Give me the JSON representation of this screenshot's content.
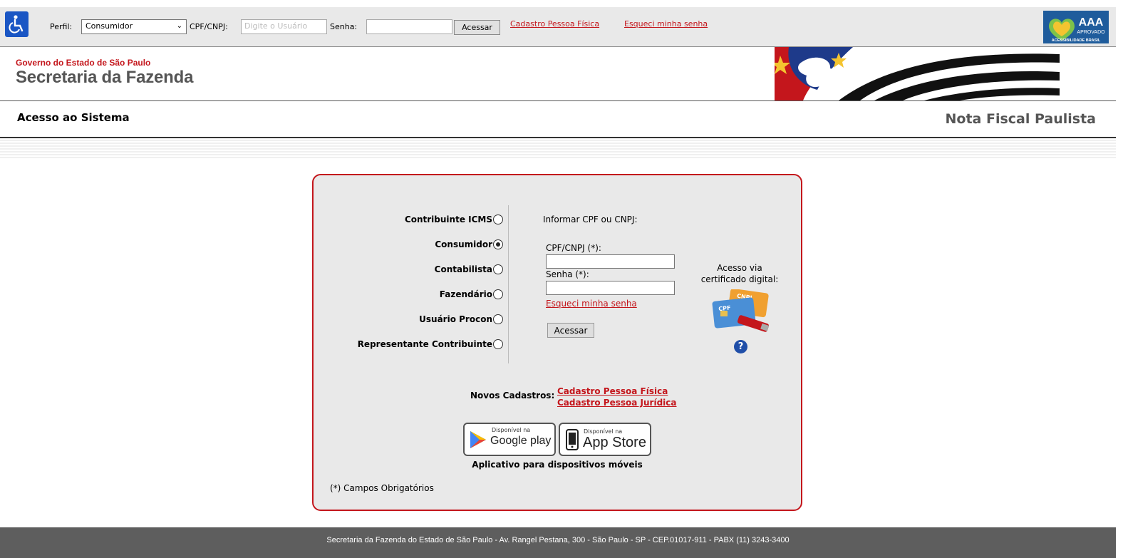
{
  "topbar": {
    "perfil_label": "Perfil:",
    "perfil_selected": "Consumidor",
    "cpf_label": "CPF/CNPJ:",
    "cpf_placeholder": "Digite o Usuário",
    "senha_label": "Senha:",
    "acessar_label": "Acessar",
    "link_cadastro": "Cadastro Pessoa Física",
    "link_esqueci": "Esqueci minha senha",
    "badge": {
      "title": "AAA",
      "sub": "APROVADO",
      "caption": "ACESSIBILIDADE BRASIL"
    }
  },
  "header": {
    "gov": "Governo do Estado de São Paulo",
    "secretaria": "Secretaria da Fazenda"
  },
  "subheader": {
    "title": "Acesso ao Sistema",
    "system": "Nota Fiscal Paulista"
  },
  "login": {
    "roles": [
      {
        "label": "Contribuinte ICMS",
        "checked": false
      },
      {
        "label": "Consumidor",
        "checked": true
      },
      {
        "label": "Contabilista",
        "checked": false
      },
      {
        "label": "Fazendário",
        "checked": false
      },
      {
        "label": "Usuário Procon",
        "checked": false
      },
      {
        "label": "Representante Contribuinte",
        "checked": false
      }
    ],
    "info_title": "Informar CPF ou CNPJ:",
    "cpf_label": "CPF/CNPJ (*):",
    "senha_label": "Senha (*):",
    "forgot": "Esqueci minha senha",
    "acessar": "Acessar",
    "cert_line1": "Acesso via",
    "cert_line2": "certificado digital:",
    "cert_card1": "CNPJ",
    "cert_card2": "CPF",
    "help": "?",
    "novos_label": "Novos Cadastros:",
    "novos_links": [
      "Cadastro Pessoa Física",
      "Cadastro Pessoa Jurídica"
    ],
    "gplay_small": "Disponível na",
    "gplay_big": "Google play",
    "appstore_small": "Disponível na",
    "appstore_big": "App Store",
    "app_caption": "Aplicativo para dispositivos móveis",
    "obrigatorios": "(*) Campos Obrigatórios"
  },
  "footer": {
    "text": "Secretaria da Fazenda do Estado de São Paulo - Av. Rangel Pestana, 300 - São Paulo - SP - CEP.01017-911 - PABX (11) 3243-3400"
  },
  "colors": {
    "accent": "#c4161c",
    "footer": "#5e5e5e",
    "box": "#e9e9e9"
  }
}
